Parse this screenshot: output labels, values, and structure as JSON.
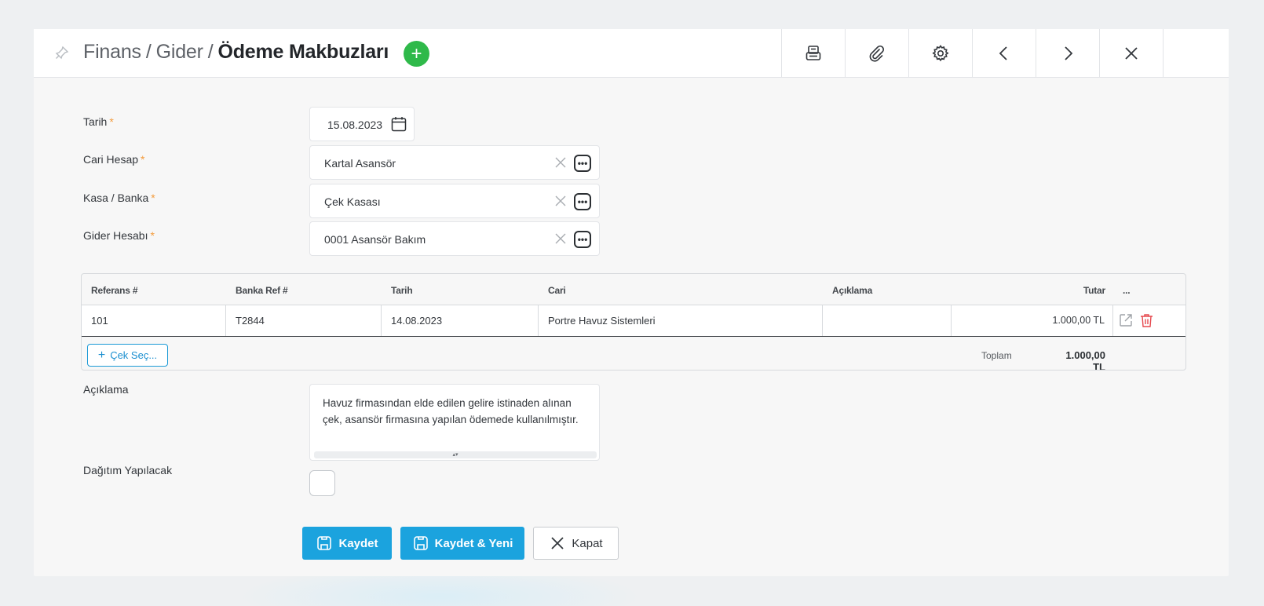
{
  "header": {
    "crumb_1": "Finans",
    "crumb_sep_1": "/",
    "crumb_2": "Gider",
    "crumb_sep_2": "/",
    "title": "Ödeme Makbuzları",
    "add_label": "+"
  },
  "toolbar": {
    "icons": [
      "printer-icon",
      "paperclip-icon",
      "gear-icon",
      "chevron-left-icon",
      "chevron-right-icon",
      "close-icon"
    ]
  },
  "form": {
    "date_label": "Tarih",
    "date_value": "15.08.2023",
    "account_label": "Cari Hesap",
    "account_value": "Kartal Asansör",
    "cashbank_label": "Kasa / Banka",
    "cashbank_value": "Çek Kasası",
    "expense_label": "Gider Hesabı",
    "expense_value": "0001 Asansör Bakım",
    "required_mark": "*",
    "more_label": "•••"
  },
  "table": {
    "headers": {
      "ref": "Referans #",
      "bank_ref": "Banka Ref #",
      "date": "Tarih",
      "account": "Cari",
      "desc": "Açıklama",
      "amount": "Tutar",
      "more": "..."
    },
    "rows": [
      {
        "ref": "101",
        "bank_ref": "T2844",
        "date": "14.08.2023",
        "account": "Portre Havuz Sistemleri",
        "desc": "",
        "amount": "1.000,00 TL"
      }
    ],
    "select_check_label": "Çek Seç...",
    "total_label": "Toplam",
    "total_value": "1.000,00 TL"
  },
  "description": {
    "label": "Açıklama",
    "value": "Havuz firmasından elde edilen gelire istinaden alınan çek, asansör firmasına yapılan ödemede kullanılmıştır.",
    "resize_glyph": "▴▾"
  },
  "distribution": {
    "label": "Dağıtım Yapılacak",
    "checked": false
  },
  "actions": {
    "save": "Kaydet",
    "save_new": "Kaydet & Yeni",
    "close": "Kapat"
  },
  "colors": {
    "accent": "#1ba3de",
    "add_button": "#2fb94a",
    "required": "#f39c3d",
    "delete": "#e5484d"
  }
}
